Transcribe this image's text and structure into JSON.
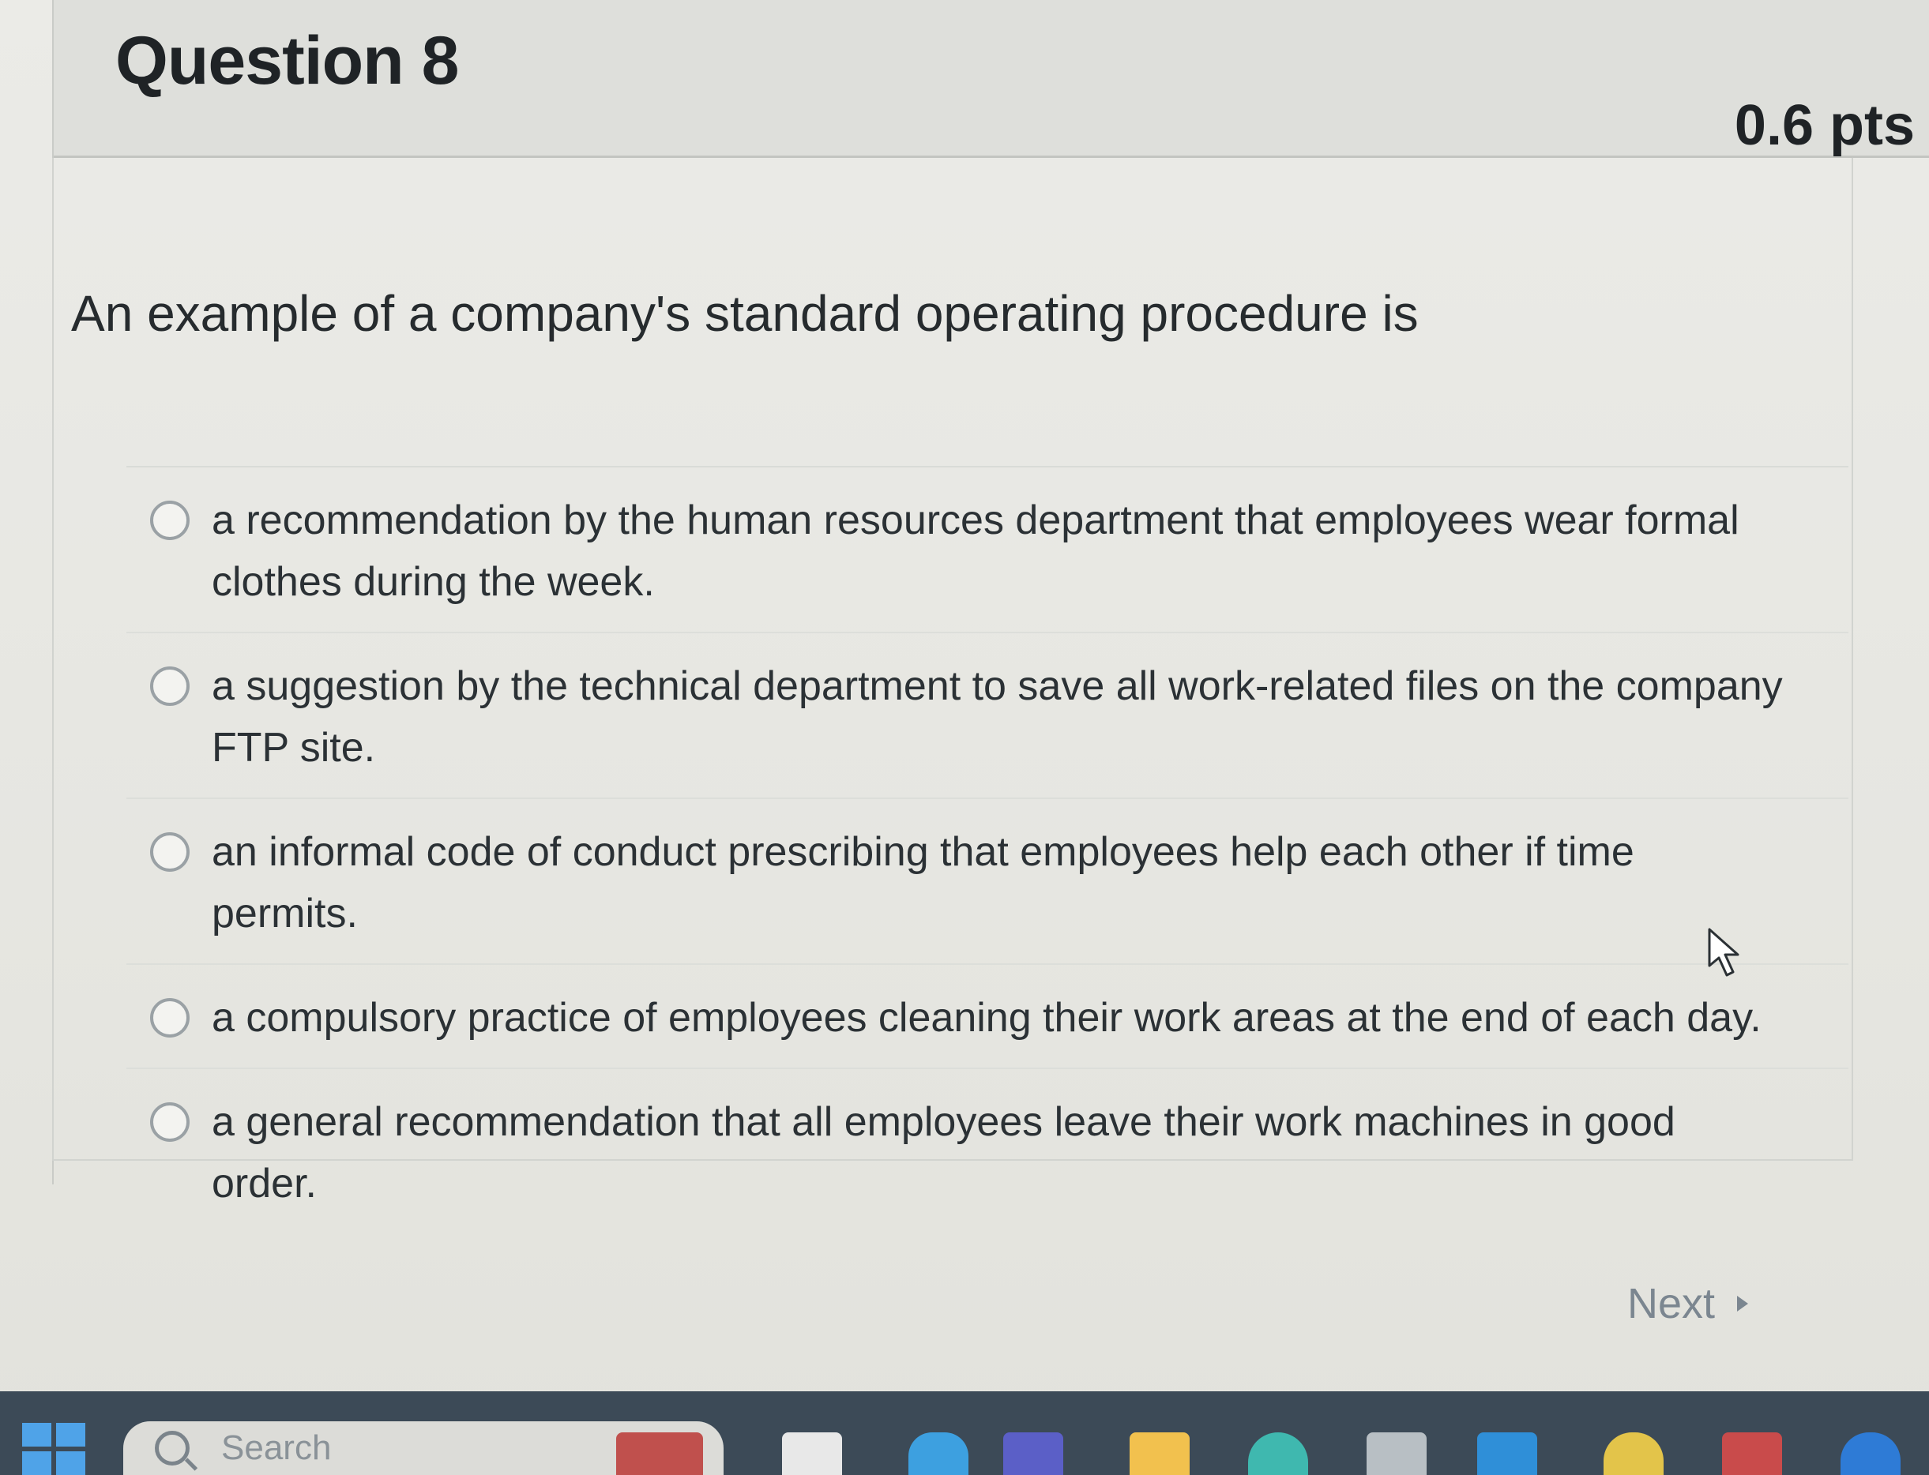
{
  "question": {
    "title": "Question 8",
    "points": "0.6 pts",
    "text": "An example of a company's standard operating procedure is"
  },
  "answers": [
    {
      "label": "a recommendation by the human resources department that employees wear formal clothes during the week."
    },
    {
      "label": "a suggestion by the technical department to save all work-related files on the company FTP site."
    },
    {
      "label": "an informal code of conduct prescribing that employees help each other if time permits."
    },
    {
      "label": "a compulsory practice of employees cleaning their work areas at the end of each day."
    },
    {
      "label": "a general recommendation that all employees leave their work machines in good order."
    }
  ],
  "navigation": {
    "next_label": "Next"
  },
  "taskbar": {
    "search_placeholder": "Search",
    "icons": [
      "windows-start-icon",
      "search-icon",
      "widgets-icon",
      "file-icon",
      "edge-icon",
      "teams-icon",
      "file-explorer-icon",
      "chrome-icon",
      "print-icon",
      "store-icon",
      "app-icon",
      "mail-icon",
      "app-icon"
    ]
  },
  "colors": {
    "taskbar": "#3c4a57",
    "header": "#dedfdb",
    "page": "#e9e9e5"
  }
}
